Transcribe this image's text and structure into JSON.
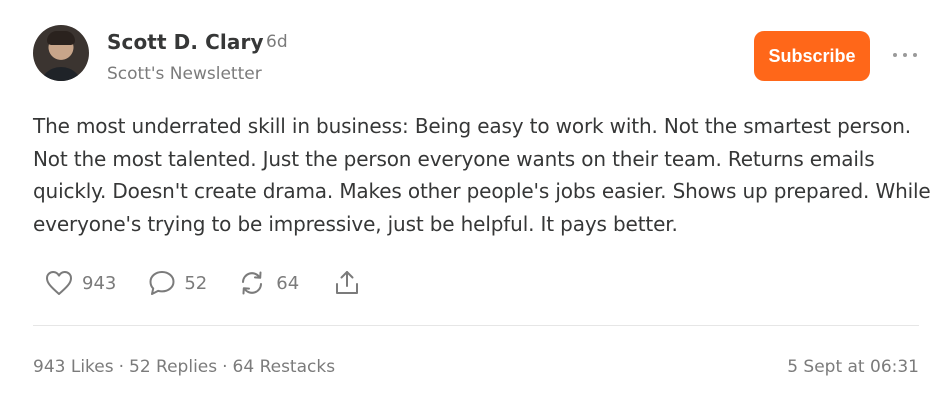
{
  "post": {
    "author": "Scott D. Clary",
    "time_ago": "6d",
    "newsletter": "Scott's Newsletter",
    "subscribe_label": "Subscribe",
    "body": "The most underrated skill in business: Being easy to work with. Not the smartest person. Not the most talented. Just the person everyone wants on their team. Returns emails quickly. Doesn't create drama. Makes other people's jobs easier. Shows up prepared. While everyone's trying to be impressive, just be helpful. It pays better.",
    "actions": {
      "likes": "943",
      "replies": "52",
      "restacks": "64"
    },
    "stats": {
      "likes": "943 Likes",
      "replies": "52 Replies",
      "restacks": "64 Restacks",
      "separator": "·"
    },
    "date": "5 Sept at 06:31"
  },
  "colors": {
    "accent": "#ff6719",
    "text": "#363737",
    "muted": "#7b7b7b"
  },
  "icons": [
    "heart-icon",
    "comment-icon",
    "restack-icon",
    "share-icon",
    "more-icon"
  ]
}
